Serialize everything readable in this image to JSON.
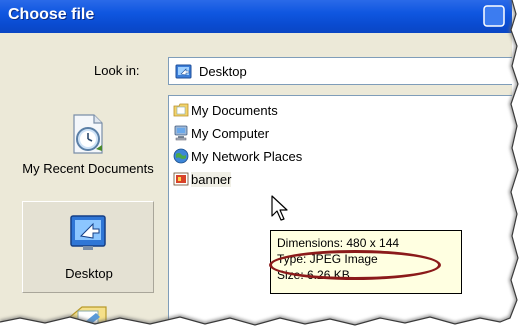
{
  "window": {
    "title": "Choose file"
  },
  "lookin": {
    "label": "Look in:",
    "value": "Desktop",
    "icon": "desktop-icon"
  },
  "places": [
    {
      "label": "My Recent Documents",
      "icon": "recent-documents-icon",
      "selected": false
    },
    {
      "label": "Desktop",
      "icon": "desktop-icon",
      "selected": true
    },
    {
      "label": "",
      "icon": "my-documents-icon",
      "selected": false
    }
  ],
  "files": [
    {
      "name": "My Documents",
      "icon": "my-documents-folder-icon"
    },
    {
      "name": "My Computer",
      "icon": "my-computer-icon"
    },
    {
      "name": "My Network Places",
      "icon": "network-places-icon"
    },
    {
      "name": "banner",
      "icon": "image-file-icon"
    }
  ],
  "tooltip": {
    "dimensions": "Dimensions: 480 x 144",
    "type": "Type: JPEG Image",
    "size": "Size: 6.26 KB"
  },
  "colors": {
    "titlebar": "#0a4bd0",
    "dialog_bg": "#ece9d8",
    "tooltip_bg": "#ffffe1",
    "highlight_ring": "#8b1a1a"
  }
}
